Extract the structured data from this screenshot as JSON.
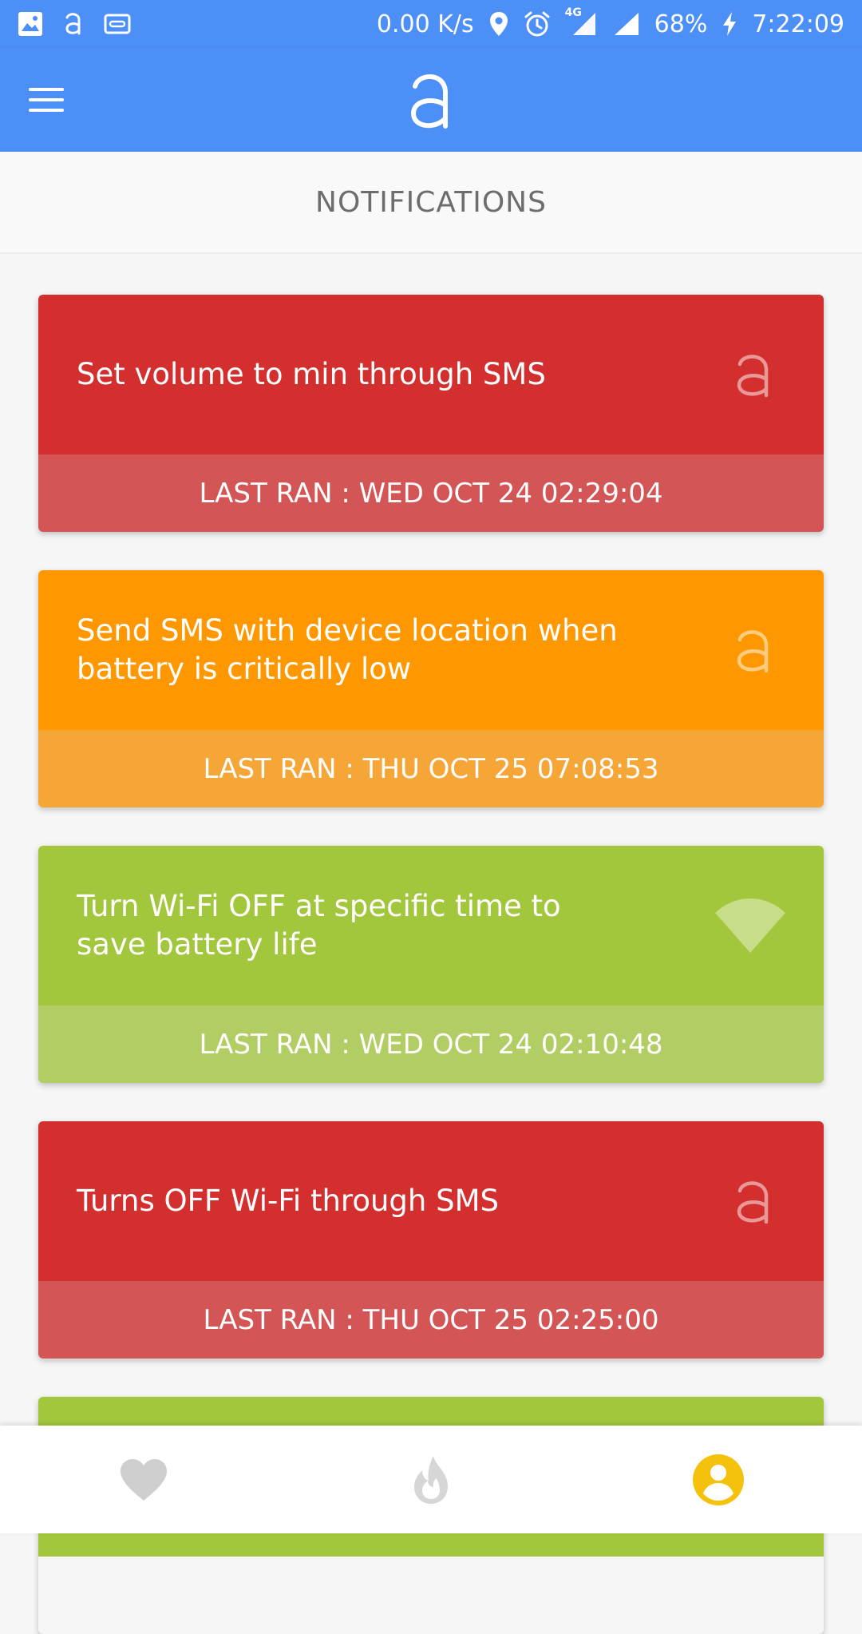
{
  "status_bar": {
    "network_speed": "0.00 K/s",
    "network_type": "4G",
    "battery": "68%",
    "time": "7:22:09"
  },
  "page": {
    "section_title": "NOTIFICATIONS"
  },
  "cards": [
    {
      "title": "Set volume to min through SMS",
      "last_ran": "LAST RAN : WED OCT 24 02:29:04",
      "icon": "app-logo-icon",
      "top_color": "#d32f2f",
      "bottom_color": "#d45555"
    },
    {
      "title": "Send SMS with device location when battery is critically low",
      "last_ran": "LAST RAN : THU OCT 25 07:08:53",
      "icon": "app-logo-icon",
      "top_color": "#ff9800",
      "bottom_color": "#f6a637"
    },
    {
      "title": "Turn Wi-Fi OFF at specific time to save battery life",
      "last_ran": "LAST RAN : WED OCT 24 02:10:48",
      "icon": "wifi-icon",
      "top_color": "#a2c63c",
      "bottom_color": "#b1cd63"
    },
    {
      "title": "Turns OFF Wi-Fi through SMS",
      "last_ran": "LAST RAN : THU OCT 25 02:25:00",
      "icon": "app-logo-icon",
      "top_color": "#d32f2f",
      "bottom_color": "#d45555"
    },
    {
      "title": "",
      "last_ran": "",
      "icon": "",
      "top_color": "#a2c63c",
      "bottom_color": "#b1cd63"
    }
  ],
  "bottom_nav": [
    {
      "icon": "heart-icon",
      "color": "#cfcfcf"
    },
    {
      "icon": "flame-icon",
      "color": "#d6d6d6"
    },
    {
      "icon": "profile-icon",
      "color": "#f4c20d",
      "active": true
    }
  ],
  "colors": {
    "primary": "#4b8ff7",
    "background": "#f6f6f6"
  }
}
